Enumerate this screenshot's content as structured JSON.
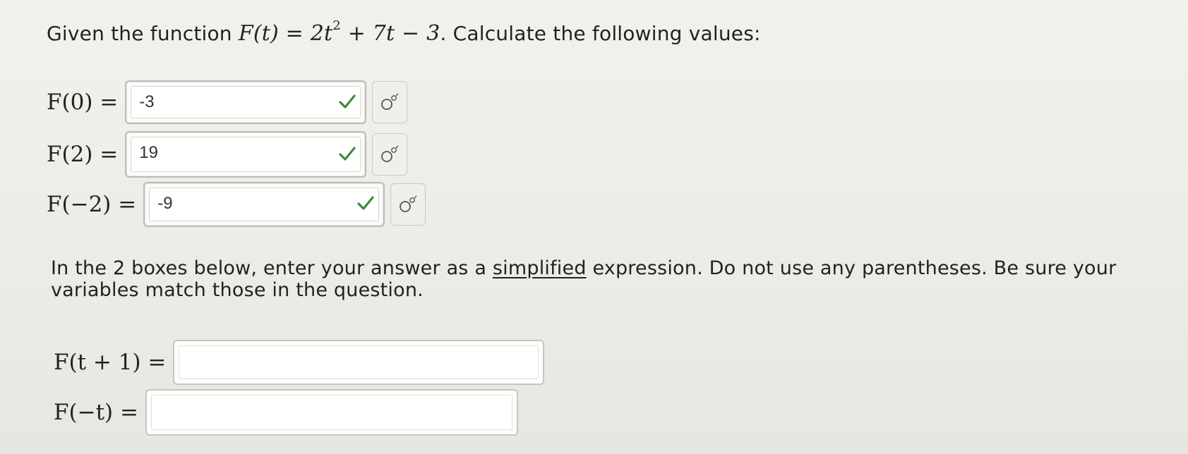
{
  "intro": {
    "text_before": "Given the function ",
    "func_lhs": "F(t) = 2t",
    "exponent": "2",
    "func_rhs": " + 7t − 3",
    "text_after": ". Calculate the following values:"
  },
  "answers": [
    {
      "label": "F(0) =",
      "value": "-3"
    },
    {
      "label": "F(2) =",
      "value": "19"
    },
    {
      "label": "F(−2) =",
      "value": "-9"
    }
  ],
  "instructions": {
    "part1": "In the 2 boxes below, enter your answer as a ",
    "underlined": "simplified",
    "part2": " expression. Do not use any parentheses. Be sure your variables match those in the question."
  },
  "expressions": [
    {
      "label": "F(t + 1) =",
      "value": ""
    },
    {
      "label": "F(−t) =",
      "value": ""
    }
  ],
  "colors": {
    "check": "#3e8a3a",
    "key_icon": "#555555"
  },
  "icons": {
    "correct": "check-icon",
    "keyboard": "math-symbol-icon"
  }
}
